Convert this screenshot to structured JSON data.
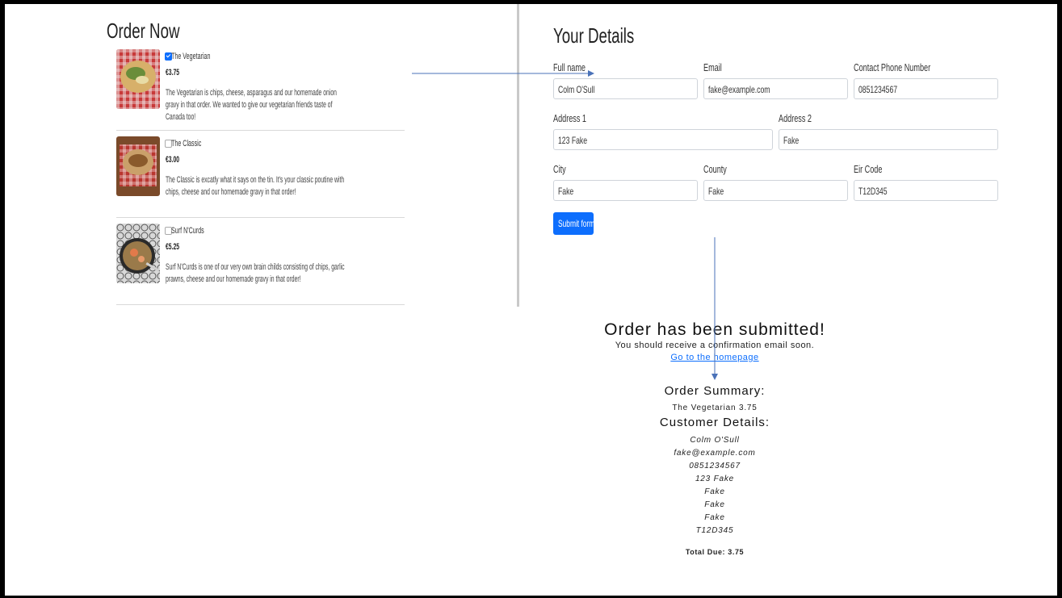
{
  "order_section": {
    "title": "Order Now",
    "items": [
      {
        "name": "The Vegetarian",
        "price": "€3.75",
        "description": "The Vegetarian is chips, cheese, asparagus and our homemade onion gravy in that order. We wanted to give our vegetarian friends taste of Canada too!",
        "checked": true
      },
      {
        "name": "The Classic",
        "price": "€3.00",
        "description": "The Classic is excatly what it says on the tin. It's your classic poutine with chips, cheese and our homemade gravy in that order!",
        "checked": false
      },
      {
        "name": "Surf N'Curds",
        "price": "€5.25",
        "description": "Surf N'Curds is one of our very own brain childs consisting of chips, garlic prawns, cheese and our homemade gravy in that order!",
        "checked": false
      }
    ]
  },
  "details_section": {
    "title": "Your Details",
    "fields": {
      "full_name": {
        "label": "Full name",
        "value": "Colm O'Sull"
      },
      "email": {
        "label": "Email",
        "value": "fake@example.com"
      },
      "phone": {
        "label": "Contact Phone Number",
        "value": "0851234567"
      },
      "address1": {
        "label": "Address 1",
        "value": "123 Fake"
      },
      "address2": {
        "label": "Address 2",
        "value": "Fake"
      },
      "city": {
        "label": "City",
        "value": "Fake"
      },
      "county": {
        "label": "County",
        "value": "Fake"
      },
      "eircode": {
        "label": "Eir Code",
        "value": "T12D345"
      }
    },
    "submit_label": "Submit form"
  },
  "confirmation": {
    "title": "Order has been submitted!",
    "subtitle": "You should receive a confirmation email soon.",
    "home_link": "Go to the homepage",
    "summary_heading": "Order Summary:",
    "summary_line": "The Vegetarian 3.75",
    "customer_heading": "Customer Details:",
    "customer_lines": [
      "Colm O'Sull",
      "fake@example.com",
      "0851234567",
      "123 Fake",
      "Fake",
      "Fake",
      "Fake",
      "T12D345"
    ],
    "total": "Total Due: 3.75"
  },
  "colors": {
    "accent": "#0d6efd",
    "arrow": "#4a72b8",
    "frame": "#000000"
  }
}
